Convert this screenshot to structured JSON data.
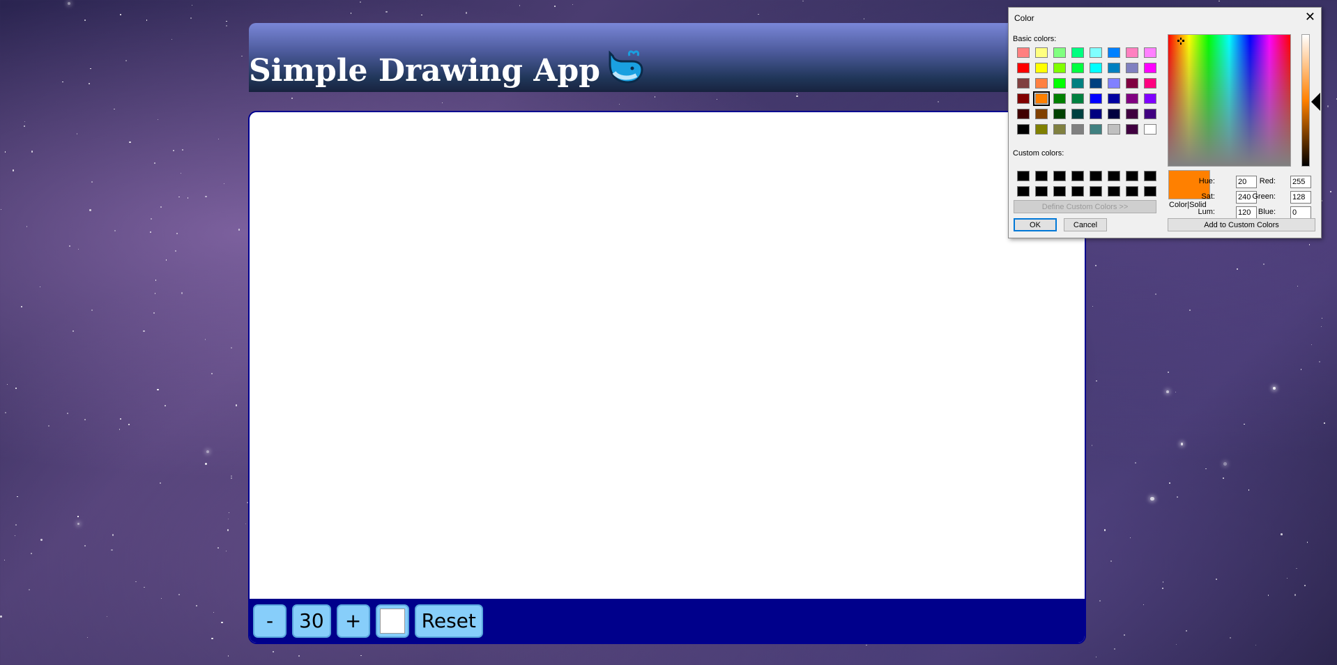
{
  "app": {
    "title": "Simple Drawing App",
    "title_emoji": "whale-icon"
  },
  "toolbar": {
    "decrease_label": "-",
    "size_value": "30",
    "increase_label": "+",
    "color_value": "#ffffff",
    "reset_label": "Reset"
  },
  "color_dialog": {
    "title": "Color",
    "basic_colors_label": "Basic colors:",
    "custom_colors_label": "Custom colors:",
    "define_custom_label": "Define Custom Colors >>",
    "ok_label": "OK",
    "cancel_label": "Cancel",
    "color_solid_label": "Color|Solid",
    "add_custom_label": "Add to Custom Colors",
    "hue_label": "Hue:",
    "sat_label": "Sat:",
    "lum_label": "Lum:",
    "red_label": "Red:",
    "green_label": "Green:",
    "blue_label": "Blue:",
    "hue": "20",
    "sat": "240",
    "lum": "120",
    "red": "255",
    "green": "128",
    "blue": "0",
    "selected_color": "#ff8000",
    "basic_colors": [
      "#ff8080",
      "#ffff80",
      "#80ff80",
      "#00ff80",
      "#80ffff",
      "#0080ff",
      "#ff80c0",
      "#ff80ff",
      "#ff0000",
      "#ffff00",
      "#80ff00",
      "#00ff40",
      "#00ffff",
      "#0080c0",
      "#8080c0",
      "#ff00ff",
      "#804040",
      "#ff8040",
      "#00ff00",
      "#008080",
      "#004080",
      "#8080ff",
      "#800040",
      "#ff0080",
      "#800000",
      "#ff8000",
      "#008000",
      "#008040",
      "#0000ff",
      "#0000a0",
      "#800080",
      "#8000ff",
      "#400000",
      "#804000",
      "#004000",
      "#004040",
      "#000080",
      "#000040",
      "#400040",
      "#400080",
      "#000000",
      "#808000",
      "#808040",
      "#808080",
      "#408080",
      "#c0c0c0",
      "#400040",
      "#ffffff"
    ],
    "custom_colors": [
      "#000000",
      "#000000",
      "#000000",
      "#000000",
      "#000000",
      "#000000",
      "#000000",
      "#000000",
      "#000000",
      "#000000",
      "#000000",
      "#000000",
      "#000000",
      "#000000",
      "#000000",
      "#000000"
    ]
  }
}
